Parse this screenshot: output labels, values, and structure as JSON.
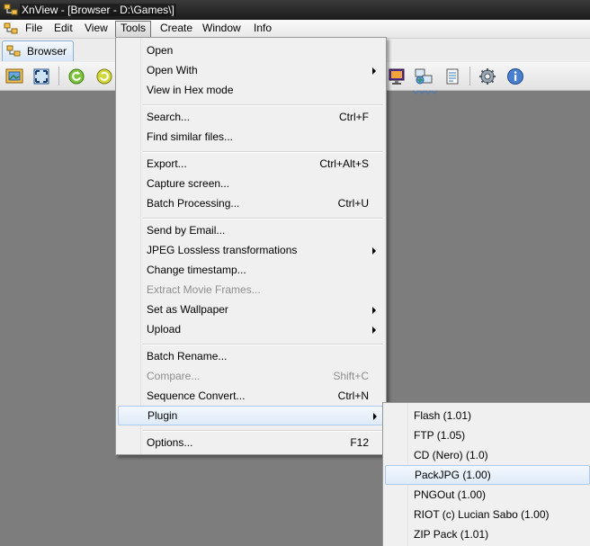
{
  "window": {
    "title": "XnView - [Browser - D:\\Games\\]"
  },
  "menubar": {
    "items": [
      {
        "label": "File"
      },
      {
        "label": "Edit"
      },
      {
        "label": "View"
      },
      {
        "label": "Tools"
      },
      {
        "label": "Create"
      },
      {
        "label": "Window"
      },
      {
        "label": "Info"
      }
    ]
  },
  "tabs": [
    {
      "label": "Browser"
    }
  ],
  "toolbar": {
    "icons": [
      "open-image-icon",
      "fullscreen-icon",
      "rotate-left-icon",
      "rotate-right-icon",
      "wallpaper-icon",
      "network-icon",
      "properties-icon",
      "settings-icon",
      "info-icon"
    ]
  },
  "tools_menu": {
    "items": [
      {
        "label": "Open",
        "shortcut": "",
        "enabled": true,
        "submenu": false
      },
      {
        "label": "Open With",
        "shortcut": "",
        "enabled": true,
        "submenu": true
      },
      {
        "label": "View in Hex mode",
        "shortcut": "",
        "enabled": true,
        "submenu": false
      },
      {
        "label": "Search...",
        "shortcut": "Ctrl+F",
        "enabled": true,
        "submenu": false
      },
      {
        "label": "Find similar files...",
        "shortcut": "",
        "enabled": true,
        "submenu": false
      },
      {
        "label": "Export...",
        "shortcut": "Ctrl+Alt+S",
        "enabled": true,
        "submenu": false
      },
      {
        "label": "Capture screen...",
        "shortcut": "",
        "enabled": true,
        "submenu": false
      },
      {
        "label": "Batch Processing...",
        "shortcut": "Ctrl+U",
        "enabled": true,
        "submenu": false
      },
      {
        "label": "Send by Email...",
        "shortcut": "",
        "enabled": true,
        "submenu": false
      },
      {
        "label": "JPEG Lossless transformations",
        "shortcut": "",
        "enabled": true,
        "submenu": true
      },
      {
        "label": "Change timestamp...",
        "shortcut": "",
        "enabled": true,
        "submenu": false
      },
      {
        "label": "Extract Movie Frames...",
        "shortcut": "",
        "enabled": false,
        "submenu": false
      },
      {
        "label": "Set as Wallpaper",
        "shortcut": "",
        "enabled": true,
        "submenu": true
      },
      {
        "label": "Upload",
        "shortcut": "",
        "enabled": true,
        "submenu": true
      },
      {
        "label": "Batch Rename...",
        "shortcut": "",
        "enabled": true,
        "submenu": false
      },
      {
        "label": "Compare...",
        "shortcut": "Shift+C",
        "enabled": false,
        "submenu": false
      },
      {
        "label": "Sequence Convert...",
        "shortcut": "Ctrl+N",
        "enabled": true,
        "submenu": false
      },
      {
        "label": "Plugin",
        "shortcut": "",
        "enabled": true,
        "submenu": true,
        "highlighted": true
      },
      {
        "label": "Options...",
        "shortcut": "F12",
        "enabled": true,
        "submenu": false
      }
    ]
  },
  "plugin_menu": {
    "items": [
      {
        "label": "Flash (1.01)"
      },
      {
        "label": "FTP (1.05)"
      },
      {
        "label": "CD (Nero) (1.0)"
      },
      {
        "label": "PackJPG (1.00)",
        "highlighted": true
      },
      {
        "label": "PNGOut (1.00)"
      },
      {
        "label": "RIOT (c) Lucian Sabo (1.00)"
      },
      {
        "label": "ZIP Pack (1.01)"
      }
    ]
  },
  "colors": {
    "titlebar": "#1c1c1c",
    "workspace": "#7d7d7d",
    "menu_background": "#f0f0f0",
    "highlight": "#dfebf8",
    "disabled_text": "#8e8e8e"
  }
}
